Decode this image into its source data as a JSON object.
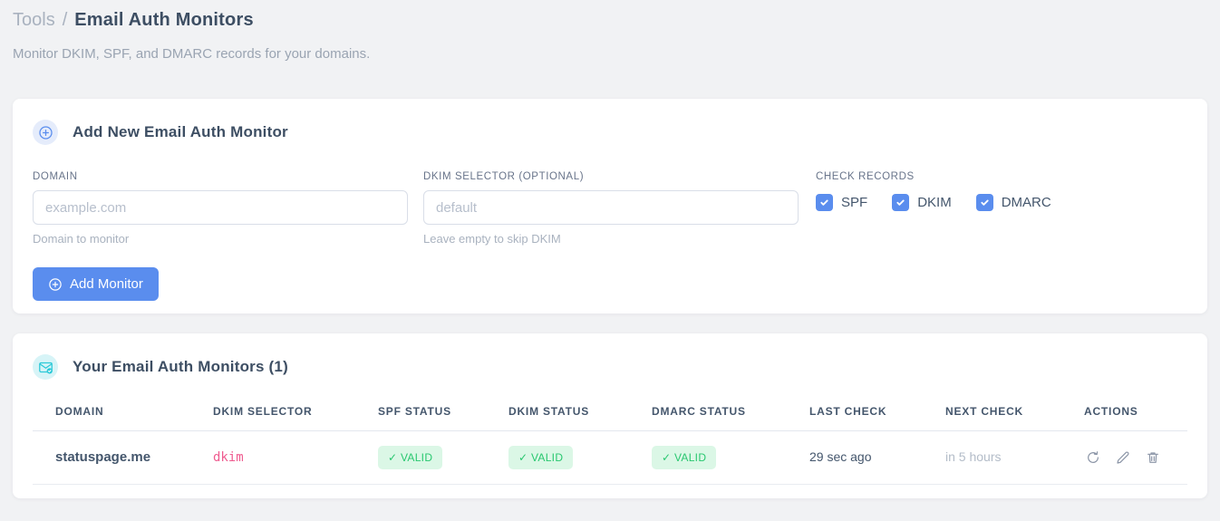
{
  "colors": {
    "accent_blue": "#5a8dee",
    "accent_blue_bg": "#e5ecfb",
    "accent_cyan": "#2bc9d8",
    "accent_cyan_bg": "#d7f4f7",
    "success_text": "#28c76f",
    "success_bg": "#dbf7e6",
    "selector_pink": "#ef5b8f",
    "page_bg": "#f1f2f4"
  },
  "breadcrumb": {
    "section": "Tools",
    "separator": "/",
    "page": "Email Auth Monitors"
  },
  "subtitle": "Monitor DKIM, SPF, and DMARC records for your domains.",
  "add_form": {
    "icon": "plus-circle-icon",
    "title": "Add New Email Auth Monitor",
    "domain_field": {
      "label": "DOMAIN",
      "value": "",
      "placeholder": "example.com",
      "hint": "Domain to monitor"
    },
    "dkim_field": {
      "label": "DKIM SELECTOR (OPTIONAL)",
      "value": "",
      "placeholder": "default",
      "hint": "Leave empty to skip DKIM"
    },
    "check_records": {
      "label": "CHECK RECORDS",
      "options": [
        {
          "label": "SPF",
          "checked": true
        },
        {
          "label": "DKIM",
          "checked": true
        },
        {
          "label": "DMARC",
          "checked": true
        }
      ]
    },
    "submit_label": "Add Monitor",
    "submit_icon": "plus-circle-icon"
  },
  "monitors": {
    "icon": "email-check-icon",
    "title": "Your Email Auth Monitors (1)",
    "count": 1,
    "table": {
      "columns": [
        "DOMAIN",
        "DKIM SELECTOR",
        "SPF STATUS",
        "DKIM STATUS",
        "DMARC STATUS",
        "LAST CHECK",
        "NEXT CHECK",
        "ACTIONS"
      ],
      "rows": [
        {
          "domain": "statuspage.me",
          "dkim_selector": "dkim",
          "spf_status": "✓ VALID",
          "dkim_status": "✓ VALID",
          "dmarc_status": "✓ VALID",
          "last_check": "29 sec ago",
          "next_check": "in 5 hours",
          "action_icons": [
            "refresh-icon",
            "edit-icon",
            "delete-icon"
          ]
        }
      ]
    }
  }
}
